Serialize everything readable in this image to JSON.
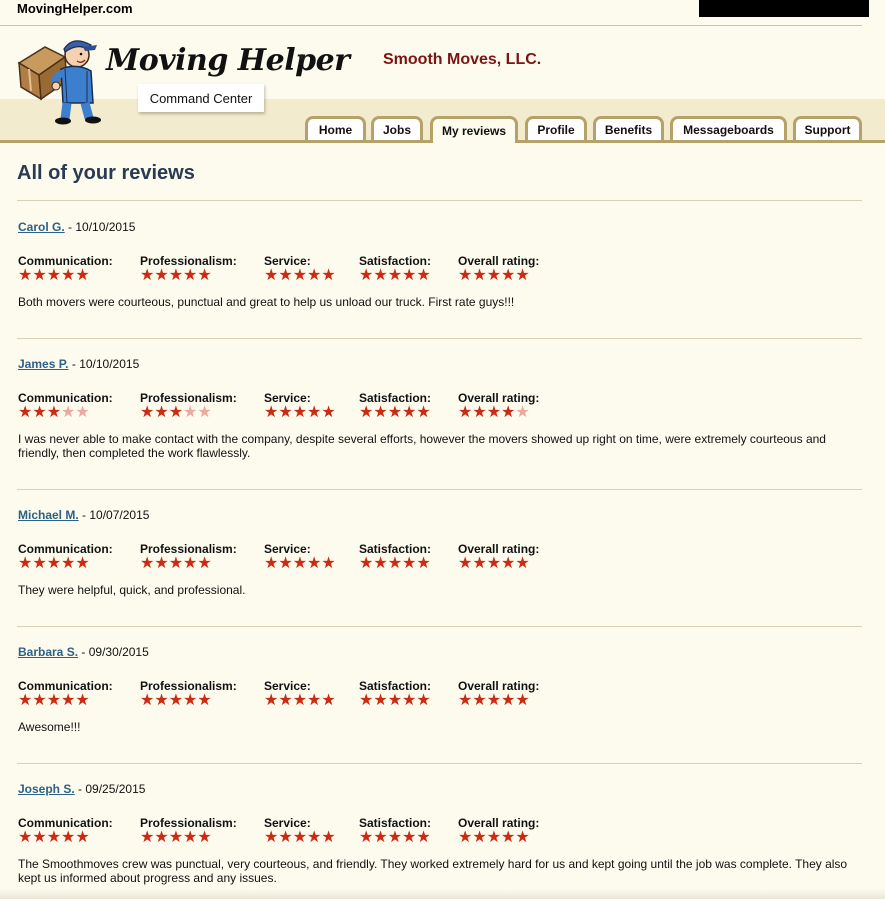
{
  "site": {
    "name": "MovingHelper.com"
  },
  "header": {
    "logo_text": "Moving Helper",
    "logo_mark": "®",
    "company": "Smooth Moves, LLC.",
    "command_center": "Command Center"
  },
  "nav": {
    "tabs": [
      {
        "label": "Home",
        "active": false
      },
      {
        "label": "Jobs",
        "active": false
      },
      {
        "label": "My reviews",
        "active": true
      },
      {
        "label": "Profile",
        "active": false
      },
      {
        "label": "Benefits",
        "active": false
      },
      {
        "label": "Messageboards",
        "active": false
      },
      {
        "label": "Support",
        "active": false
      }
    ]
  },
  "page": {
    "title": "All of your reviews"
  },
  "rating_labels": [
    "Communication:",
    "Professionalism:",
    "Service:",
    "Satisfaction:",
    "Overall rating:"
  ],
  "colors": {
    "star_full": "#cc2a12",
    "star_empty": "#eba9a0",
    "link": "#2d6185",
    "company": "#7d1414"
  },
  "reviews": [
    {
      "name": "Carol G.",
      "sep": "- ",
      "date": "10/10/2015",
      "ratings": [
        5,
        5,
        5,
        5,
        5
      ],
      "text": "Both movers were courteous, punctual and great to help us unload our truck. First rate guys!!!"
    },
    {
      "name": "James P.",
      "sep": "- ",
      "date": "10/10/2015",
      "ratings": [
        3,
        3,
        5,
        5,
        4
      ],
      "text": "I was never able to make contact with the company, despite several efforts, however the movers showed up right on time, were extremely courteous and friendly, then completed the work flawlessly."
    },
    {
      "name": "Michael M.",
      "sep": "- ",
      "date": "10/07/2015",
      "ratings": [
        5,
        5,
        5,
        5,
        5
      ],
      "text": "They were helpful, quick, and professional."
    },
    {
      "name": "Barbara S.",
      "sep": "- ",
      "date": "09/30/2015",
      "ratings": [
        5,
        5,
        5,
        5,
        5
      ],
      "text": "Awesome!!!"
    },
    {
      "name": "Joseph S.",
      "sep": "- ",
      "date": "09/25/2015",
      "ratings": [
        5,
        5,
        5,
        5,
        5
      ],
      "text": "The Smoothmoves crew was punctual, very courteous, and friendly. They worked extremely hard for us and kept going until the job was complete. They also kept us informed about progress and any issues."
    }
  ]
}
